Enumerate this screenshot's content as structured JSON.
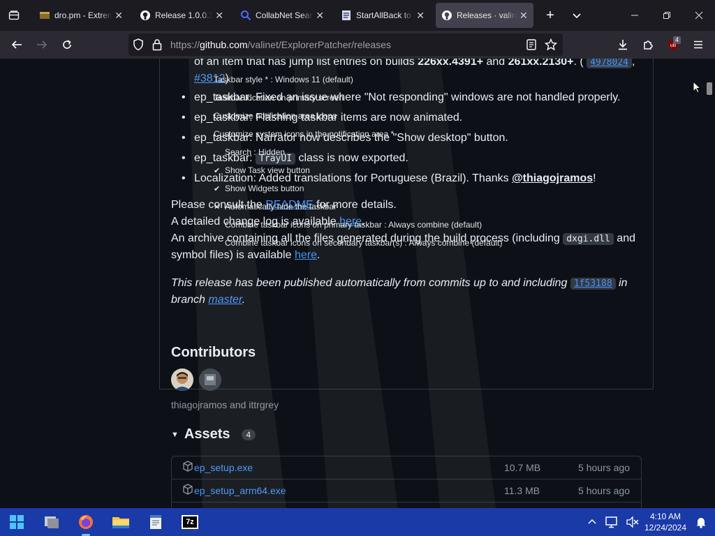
{
  "browser": {
    "tabs": [
      {
        "title": "dro.pm - Extrem",
        "icon": "dropm-icon",
        "active": false
      },
      {
        "title": "Release 1.0.0.3 -",
        "icon": "github-icon",
        "active": false
      },
      {
        "title": "CollabNet Search",
        "icon": "search-icon",
        "active": false
      },
      {
        "title": "StartAllBack to f",
        "icon": "document-icon",
        "active": false
      },
      {
        "title": "Releases · valinet",
        "icon": "github-icon",
        "active": true
      }
    ],
    "new_tab_symbol": "+",
    "url_prefix": "https://",
    "url_domain": "github.com",
    "url_path": "/valinet/ExplorerPatcher/releases",
    "extension_badge": "4"
  },
  "release": {
    "line0_text": "of an item that has jump list entries on builds ",
    "line0_bold1": "226xx.4391+",
    "line0_and": " and ",
    "line0_bold2": "261xx.2130+",
    "line0_tail": ". (",
    "line0_commit": "4978024",
    "line0_comma": ",",
    "line1_issue": "#3812",
    "line1_paren": ")",
    "notes": [
      {
        "prefix": "ep_taskbar: Fixed an issue where ",
        "emph": "\"Not responding\" windows are not handled properly.",
        "tail": ""
      },
      {
        "prefix": "ep_taskbar: Flashing taskbar items are now animated.",
        "emph": "",
        "tail": ""
      },
      {
        "prefix": "ep_taskbar: Narrator now describes the \"Show desktop\" button.",
        "emph": "",
        "tail": ""
      },
      {
        "prefix": "ep_taskbar: ",
        "code": "TrayUI",
        "tail": " class is now exported."
      },
      {
        "prefix": "Localization: Added translations for Portuguese (Brazil). Thanks ",
        "mention": "@thiagojramos",
        "tail": "!"
      }
    ],
    "consult_prefix": "Please consult the ",
    "consult_link": "README",
    "consult_suffix": " for more details.",
    "changelog_prefix": "A detailed change log is available ",
    "changelog_link": "here",
    "changelog_suffix": ".",
    "archive_prefix": "An archive containing all the files generated during the build process (including ",
    "archive_code": "dxgi.dll",
    "archive_mid": " and",
    "archive_line2": "symbol files) is available ",
    "archive_link": "here",
    "archive_suffix": ".",
    "auto_prefix": "This release has been published automatically from commits up to and including ",
    "auto_commit": "1f53188",
    "auto_mid": " in",
    "auto_line2": "branch ",
    "auto_branch": "master",
    "auto_suffix": "."
  },
  "contributors": {
    "heading": "Contributors",
    "names": "thiagojramos and ittrgrey"
  },
  "assets": {
    "heading": "Assets",
    "count": "4",
    "rows": [
      {
        "name": "ep_setup.exe",
        "size": "10.7 MB",
        "time": "5 hours ago"
      },
      {
        "name": "ep_setup_arm64.exe",
        "size": "11.3 MB",
        "time": "5 hours ago"
      }
    ]
  },
  "overlay_menu": {
    "items": [
      {
        "label": "Taskbar style * : Windows 11 (default)",
        "check": ""
      },
      {
        "label": "Taskbar location on primary screen",
        "check": ""
      },
      {
        "label": "Customize notification area icons",
        "check": ""
      },
      {
        "label": "Customize system icons in the notification area *",
        "check": ""
      },
      {
        "label": "Search : Hidden",
        "check": ""
      },
      {
        "label": "Show Task view button",
        "check": "✔"
      },
      {
        "label": "Show Widgets button",
        "check": "✔"
      },
      {
        "label": "Automatically hide the taskbar",
        "check": "✕"
      },
      {
        "label": "Combine taskbar icons on primary taskbar : Always combine (default)",
        "check": ""
      },
      {
        "label": "Combine taskbar icons on secondary taskbar(s) : Always combine (default)",
        "check": ""
      }
    ]
  },
  "taskbar": {
    "time": "4:10 AM",
    "date": "12/24/2024",
    "app_7z": "7z"
  },
  "colors": {
    "accent_link": "#4493f8",
    "page_bg": "#0d1117",
    "taskbar_bg": "#1a3aa8"
  }
}
